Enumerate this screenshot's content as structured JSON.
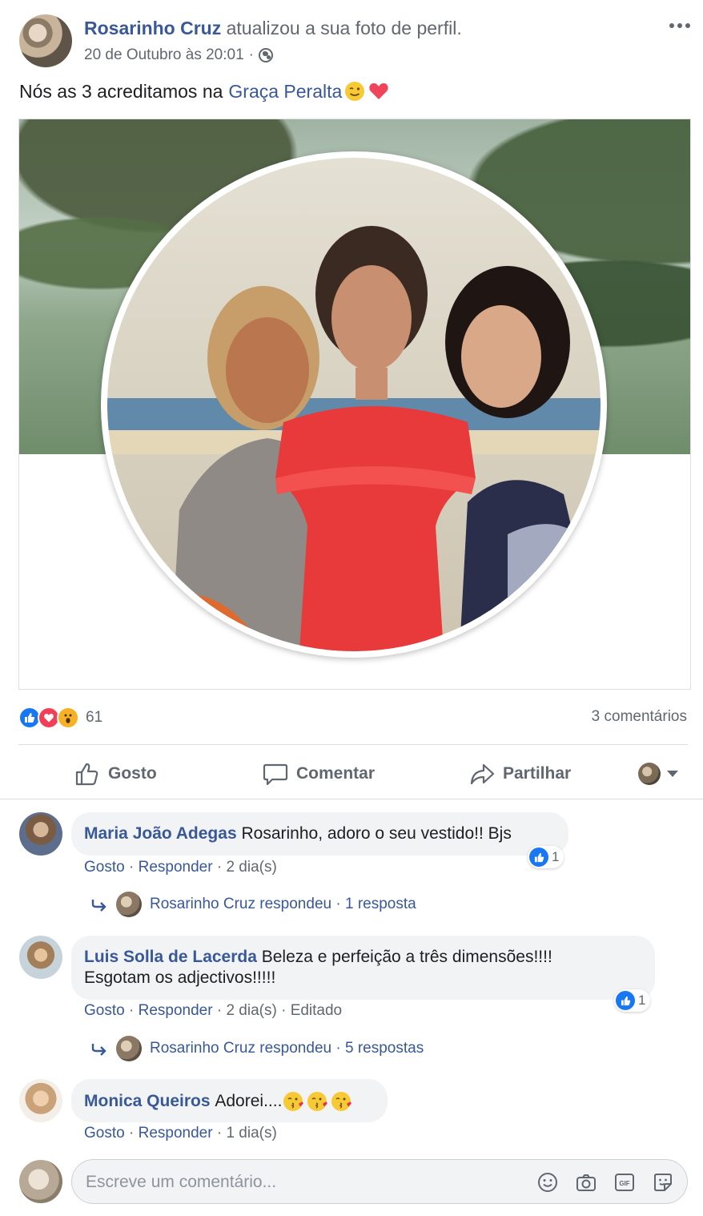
{
  "post": {
    "author": "Rosarinho Cruz",
    "action": "atualizou a sua foto de perfil.",
    "timestamp": "20 de Outubro às 20:01",
    "separator": "·",
    "audience_icon": "globe-icon",
    "caption_text": "Nós as 3 acreditamos na",
    "caption_mention": "Graça Peralta",
    "caption_emojis": [
      "wink-emoji",
      "heart-emoji"
    ]
  },
  "reactions": {
    "icons": [
      "like",
      "love",
      "wow"
    ],
    "count": "61",
    "comments_count": "3 comentários"
  },
  "actions": {
    "like": "Gosto",
    "comment": "Comentar",
    "share": "Partilhar"
  },
  "comments": [
    {
      "author": "Maria João Adegas",
      "text": "Rosarinho, adoro o seu vestido!! Bjs",
      "like": "Gosto",
      "reply": "Responder",
      "age": "2 dia(s)",
      "likes": "1",
      "reply_author": "Rosarinho Cruz respondeu",
      "reply_count": "1 resposta"
    },
    {
      "author": "Luis Solla de Lacerda",
      "text_line1": "Beleza e perfeição a três dimensões!!!!",
      "text_line2": "Esgotam os adjectivos!!!!!",
      "like": "Gosto",
      "reply": "Responder",
      "age": "2 dia(s)",
      "edited": "Editado",
      "likes": "1",
      "reply_author": "Rosarinho Cruz respondeu",
      "reply_count": "5 respostas"
    },
    {
      "author": "Monica Queiros",
      "text": "Adorei....",
      "emojis": [
        "kiss-emoji",
        "kiss-emoji",
        "kiss-emoji"
      ],
      "like": "Gosto",
      "reply": "Responder",
      "age": "1 dia(s)"
    }
  ],
  "composer": {
    "placeholder": "Escreve um comentário...",
    "icons": [
      "emoji-icon",
      "camera-icon",
      "gif-icon",
      "sticker-icon"
    ]
  },
  "colors": {
    "link": "#385898",
    "muted": "#606770",
    "like_blue": "#1877f2",
    "love_red": "#f33e58",
    "wow_yellow": "#f7b125",
    "bubble_bg": "#f2f3f5"
  }
}
